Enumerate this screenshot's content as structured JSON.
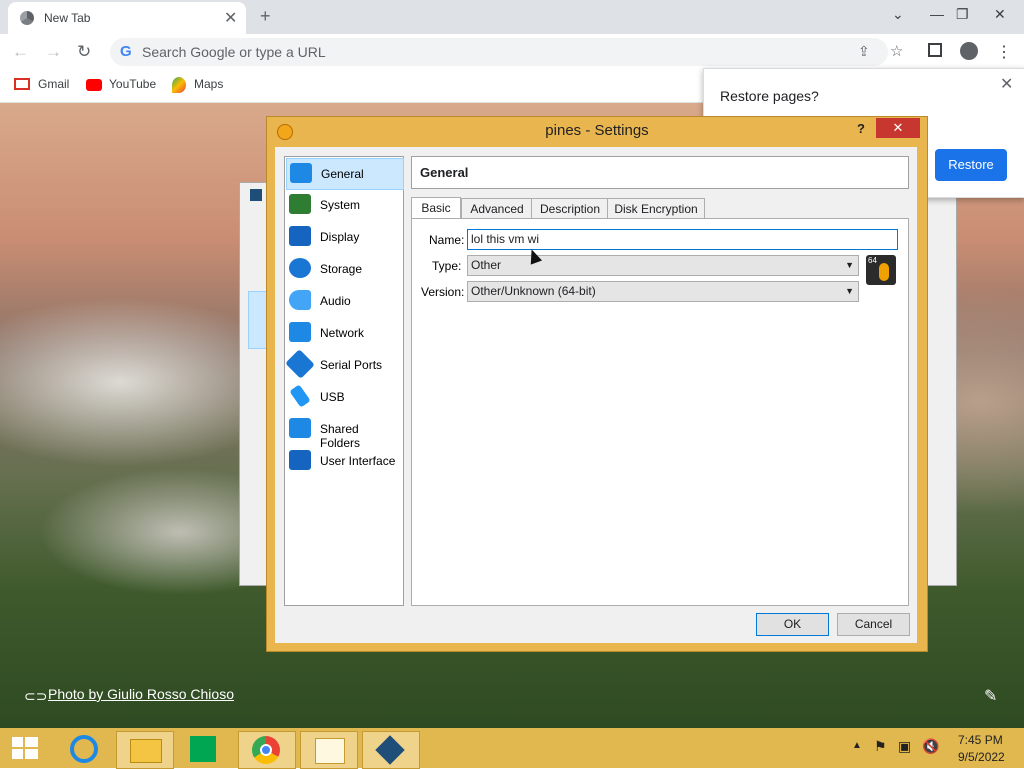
{
  "browser": {
    "tab_title": "New Tab",
    "tab_close": "✕",
    "new_tab": "+",
    "omnibox_placeholder": "Search Google or type a URL",
    "bookmarks": [
      {
        "label": "Gmail"
      },
      {
        "label": "YouTube"
      },
      {
        "label": "Maps"
      }
    ]
  },
  "restore_popup": {
    "title": "Restore pages?",
    "button": "Restore",
    "close": "✕"
  },
  "settings_dialog": {
    "title": "pines - Settings",
    "help": "?",
    "close": "✕",
    "sidebar": [
      {
        "label": "General",
        "icon": "general-icon",
        "color": "#1e88e5"
      },
      {
        "label": "System",
        "icon": "system-icon",
        "color": "#2e7d32"
      },
      {
        "label": "Display",
        "icon": "display-icon",
        "color": "#1565c0"
      },
      {
        "label": "Storage",
        "icon": "storage-icon",
        "color": "#1976d2"
      },
      {
        "label": "Audio",
        "icon": "audio-icon",
        "color": "#42a5f5"
      },
      {
        "label": "Network",
        "icon": "network-icon",
        "color": "#1e88e5"
      },
      {
        "label": "Serial Ports",
        "icon": "serial-ports-icon",
        "color": "#1976d2"
      },
      {
        "label": "USB",
        "icon": "usb-icon",
        "color": "#2196f3"
      },
      {
        "label": "Shared Folders",
        "icon": "shared-folders-icon",
        "color": "#1e88e5"
      },
      {
        "label": "User Interface",
        "icon": "user-interface-icon",
        "color": "#1565c0"
      }
    ],
    "selected_section": "General",
    "section_header": "General",
    "tabs": [
      {
        "label": "Basic"
      },
      {
        "label": "Advanced"
      },
      {
        "label": "Description"
      },
      {
        "label": "Disk Encryption"
      }
    ],
    "form": {
      "name_label": "Name:",
      "name_value": "lol this vm wi",
      "type_label": "Type:",
      "type_value": "Other",
      "version_label": "Version:",
      "version_value": "Other/Unknown (64-bit)",
      "os_badge": "64"
    },
    "ok_button": "OK",
    "cancel_button": "Cancel"
  },
  "wallpaper_credit": "Photo by Giulio Rosso Chioso",
  "taskbar": {
    "time": "7:45 PM",
    "date": "9/5/2022",
    "accent": "#e0b84f"
  }
}
